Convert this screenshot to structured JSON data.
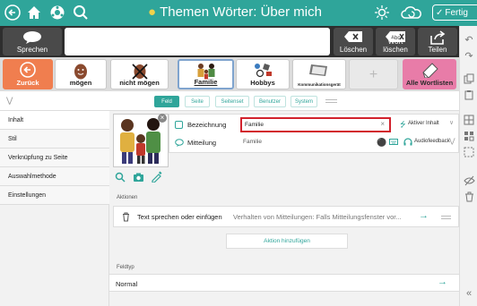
{
  "topbar": {
    "title": "Themen Wörter: Über mich",
    "done_label": "Fertig",
    "icons": [
      "back-icon",
      "home-icon",
      "settings-icon",
      "search-icon",
      "brightness-icon",
      "cloud-icon"
    ],
    "accent": "#2fa59a"
  },
  "messagebar": {
    "speak_label": "Sprechen",
    "delete_label": "Löschen",
    "delete_word_label": "Wort löschen",
    "share_label": "Teilen",
    "delete_icon_text": "Abc"
  },
  "symbols": {
    "back_label": "Zurück",
    "items": [
      "mögen",
      "nicht mögen",
      "Familie",
      "Hobbys",
      "Kommunikationsgerät"
    ],
    "all_lists_label": "Alle Wortlisten",
    "back_color": "#f07e4f",
    "all_lists_color": "#e87ca8"
  },
  "tabs": [
    "Feld",
    "Seite",
    "Seitenset",
    "Benutzer",
    "System"
  ],
  "menu": [
    "Inhalt",
    "Stil",
    "Verknüpfung zu Seite",
    "Auswahlmethode",
    "Einstellungen"
  ],
  "editor": {
    "label_field_label": "Bezeichnung",
    "label_field_value": "Familie",
    "active_content_label": "Aktiver Inhalt",
    "message_field_label": "Mitteilung",
    "message_field_value": "Familie",
    "audio_feedback_label": "Audiofeedback"
  },
  "actions": {
    "section_label": "Aktionen",
    "action_title": "Text sprechen oder einfügen",
    "action_detail": "Verhalten von Mitteilungen: Falls Mitteilungsfenster vor...",
    "add_action_label": "Aktion hinzufügen"
  },
  "fieldtype": {
    "section_label": "Feldtyp",
    "value": "Normal"
  }
}
